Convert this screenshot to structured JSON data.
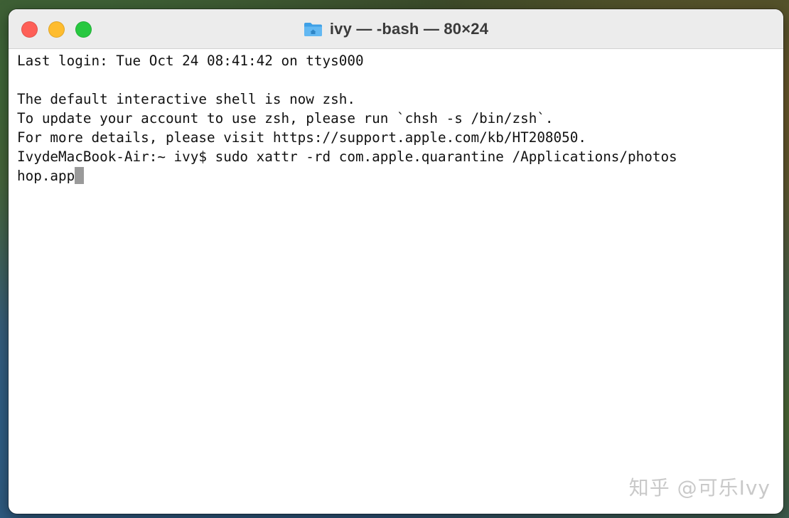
{
  "window": {
    "title": "ivy — -bash — 80×24",
    "title_icon": "folder-home-icon",
    "controls": {
      "close": {
        "icon": "close-icon",
        "color": "#fe5f57"
      },
      "minimize": {
        "icon": "minimize-icon",
        "color": "#febc2e"
      },
      "zoom": {
        "icon": "zoom-icon",
        "color": "#28c840"
      }
    }
  },
  "terminal": {
    "lines": [
      "Last login: Tue Oct 24 08:41:42 on ttys000",
      "",
      "The default interactive shell is now zsh.",
      "To update your account to use zsh, please run `chsh -s /bin/zsh`.",
      "For more details, please visit https://support.apple.com/kb/HT208050.",
      "IvydeMacBook-Air:~ ivy$ sudo xattr -rd com.apple.quarantine /Applications/photos",
      "hop.app"
    ]
  },
  "watermark": "知乎 @可乐Ivy"
}
